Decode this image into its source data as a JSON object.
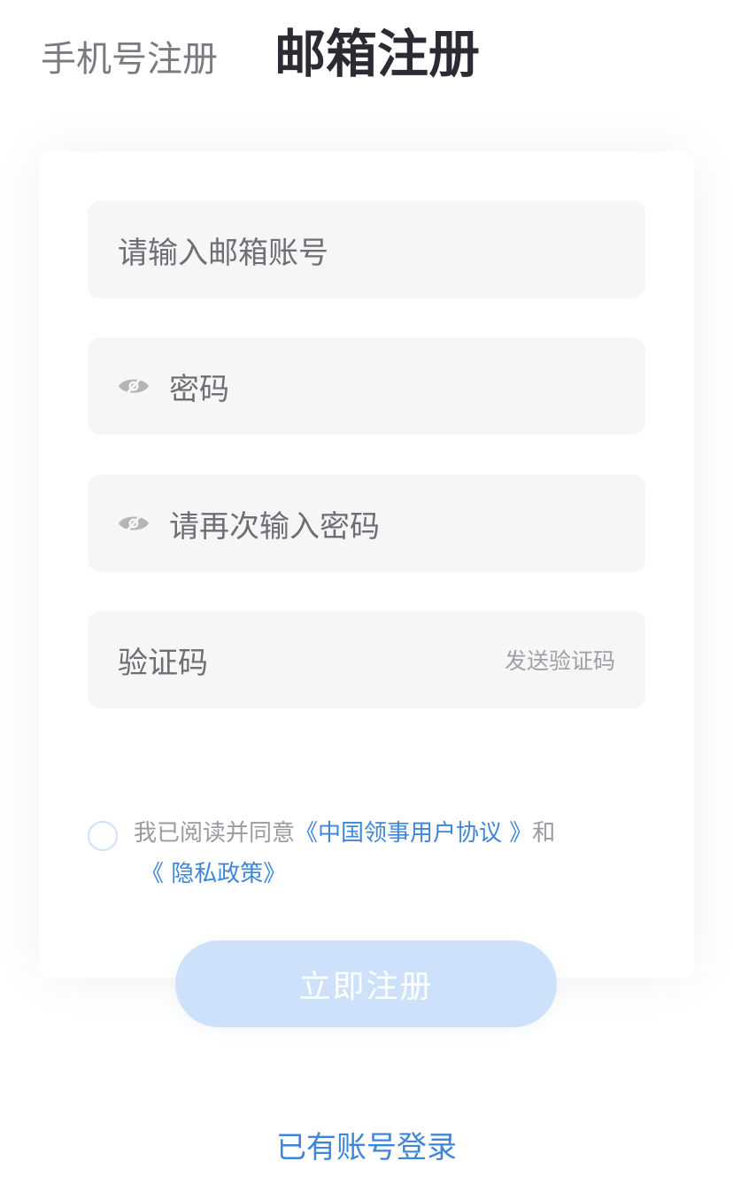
{
  "tabs": {
    "phone_label": "手机号注册",
    "email_label": "邮箱注册"
  },
  "form": {
    "email_placeholder": "请输入邮箱账号",
    "password_placeholder": "密码",
    "confirm_password_placeholder": "请再次输入密码",
    "code_placeholder": "验证码",
    "send_code_label": "发送验证码"
  },
  "agreement": {
    "checked": false,
    "prefix": "我已阅读并同意",
    "user_agreement_link": "《中国领事用户协议 》",
    "conjunction": "和",
    "privacy_link": "《 隐私政策》"
  },
  "submit_label": "立即注册",
  "login_link": "已有账号登录",
  "colors": {
    "accent": "#3f86d9",
    "button_disabled": "#cde2fa",
    "field_bg": "#f6f6f6"
  }
}
